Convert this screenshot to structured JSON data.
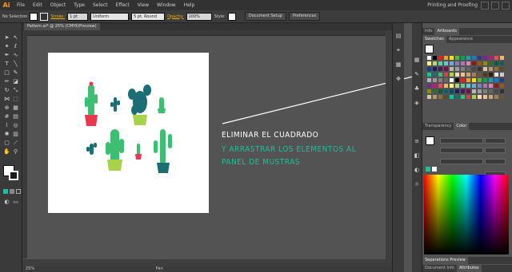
{
  "app": {
    "logo": "Ai",
    "workspace": "Printing and Proofing"
  },
  "menu": [
    "File",
    "Edit",
    "Object",
    "Type",
    "Select",
    "Effect",
    "View",
    "Window",
    "Help"
  ],
  "control": {
    "selection": "No Selection",
    "stroke_label": "Stroke:",
    "stroke_weight": "1 pt",
    "profile": "Uniform",
    "brush": "5 pt. Round",
    "opacity_label": "Opacity:",
    "opacity_value": "100%",
    "style_label": "Style:",
    "doc_setup": "Document Setup",
    "preferences": "Preferences"
  },
  "document_tab": "Pattern.ai* @ 25% (CMYK/Preview)",
  "instructions": {
    "line1": "ELIMINAR EL CUADRADO",
    "line2": "Y ARRASTRAR LOS ELEMENTOS AL",
    "line3": "PANEL DE MUSTRAS"
  },
  "status": {
    "zoom": "25%",
    "tool": "Pan"
  },
  "panels": {
    "top_tabs": [
      "Info",
      "Artboards"
    ],
    "swatch_tabs": [
      "Swatches",
      "Appearance"
    ],
    "color_tabs": [
      "Transparency",
      "Color"
    ],
    "bottom_tabs": [
      "Separations Preview"
    ],
    "footer_tabs": [
      "Document Info",
      "Attributes"
    ]
  },
  "colors": {
    "accent_green": "#1fbf9a",
    "cactus_teal": "#1b6e73",
    "cactus_green": "#3dbf72",
    "pot_red": "#e8374f",
    "pot_lime": "#a8d24a"
  }
}
